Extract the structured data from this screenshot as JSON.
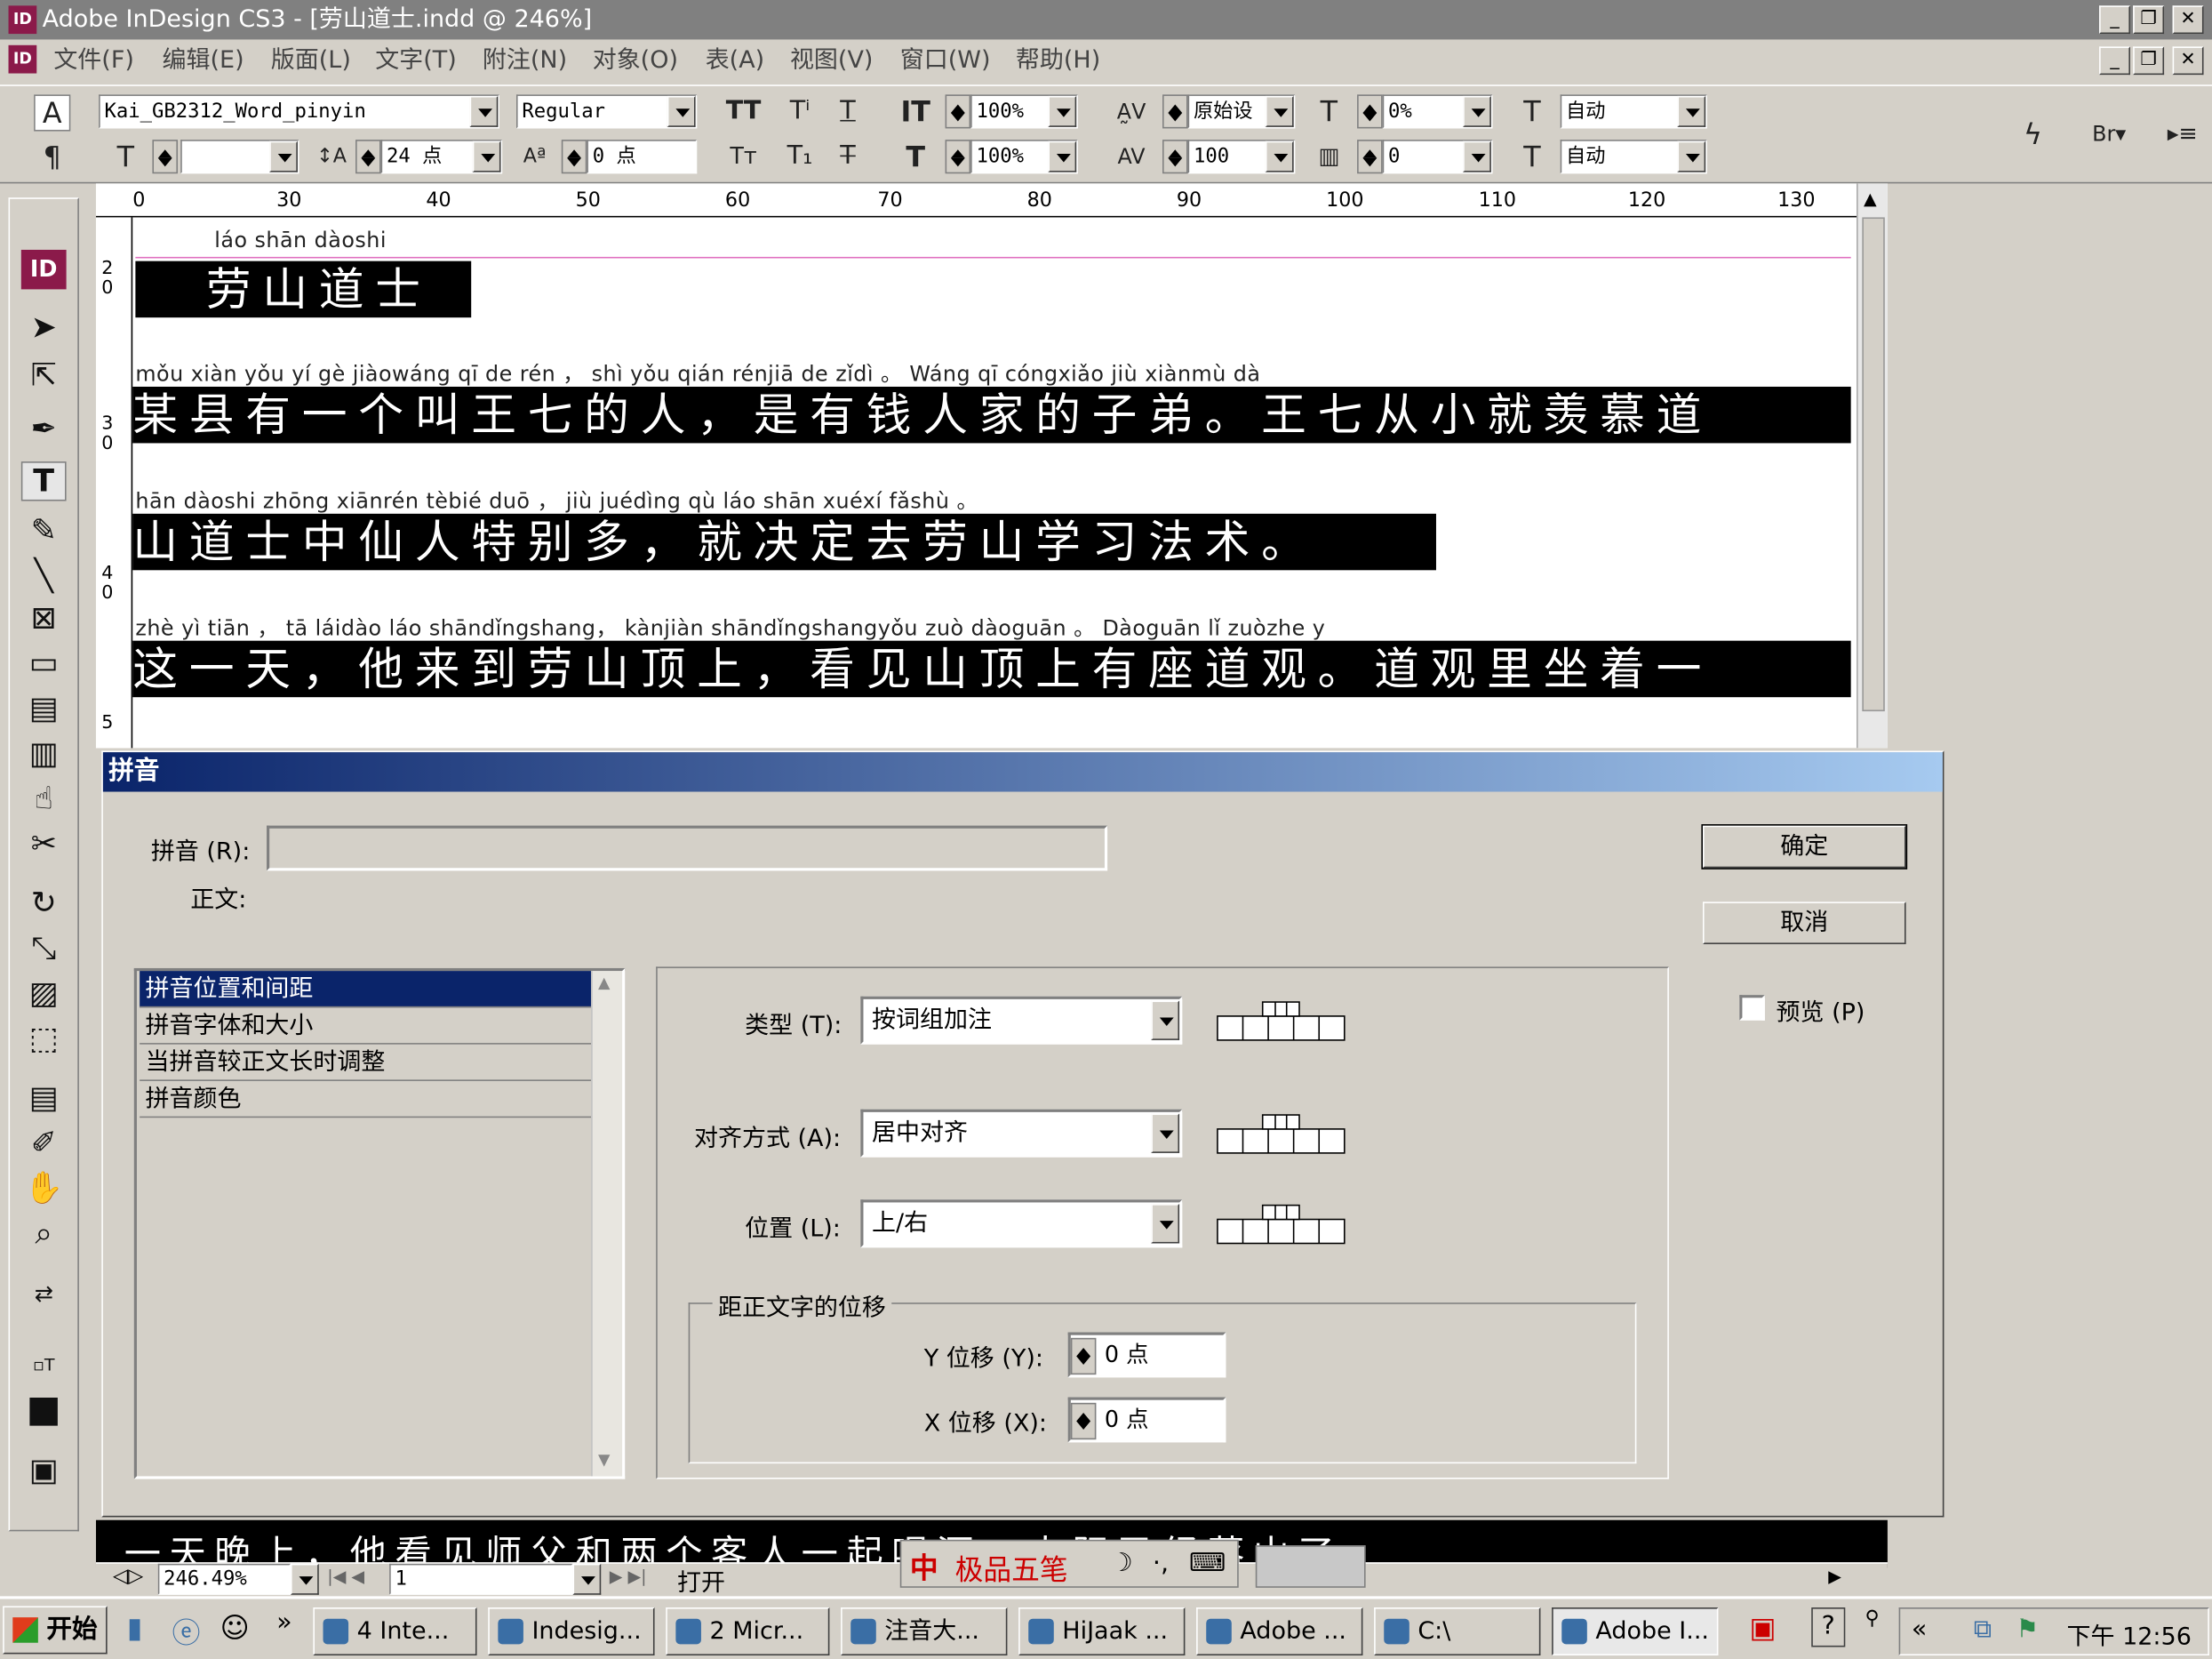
{
  "window": {
    "title": "Adobe InDesign CS3 - [劳山道士.indd @ 246%]",
    "logo": "ID"
  },
  "menu": [
    "文件(F)",
    "编辑(E)",
    "版面(L)",
    "文字(T)",
    "附注(N)",
    "对象(O)",
    "表(A)",
    "视图(V)",
    "窗口(W)",
    "帮助(H)"
  ],
  "control": {
    "font": "Kai_GB2312_Word_pinyin",
    "style": "Regular",
    "size": "24 点",
    "baseline": "0 点",
    "vscale": "100%",
    "hscale": "100%",
    "kerning": "原始设",
    "tracking": "100",
    "skew": "0%",
    "skew2": "0",
    "leading1": "自动",
    "leading2": "自动"
  },
  "ruler": [
    "0",
    "30",
    "40",
    "50",
    "60",
    "70",
    "80",
    "90",
    "100",
    "110",
    "120",
    "130"
  ],
  "vruler": [
    "2\n0",
    "3\n0",
    "4\n0",
    "5"
  ],
  "text": {
    "heading_pinyin": "láo shān  dàoshi",
    "heading": "劳山道士",
    "line1_pinyin": "mǒu xiàn yǒu   yí    gè   jiàowáng qī    de   rén     ，      shì  yǒu qián   rénjiā      de       zǐdì        。  Wáng qī  cóngxiǎo  jiù    xiànmù     dà",
    "line1": "某县有一个叫王七的人，是有钱人家的子弟。王七从小就羡慕道",
    "line2_pinyin": "hān  dàoshi zhōng xiānrén     tèbié     duō    ，      jiù    juédìng    qù   láo shān   xuéxí       fǎshù       。",
    "line2": "山道士中仙人特别多，就决定去劳山学习法术。",
    "line3_pinyin": "zhè   yì   tiān    ，     tā      láidào    láo shāndǐngshang，     kànjiàn   shāndǐngshangyǒu  zuò dàoguān  。   Dàoguān   lǐ     zuòzhe     y",
    "line3": "这一天，他来到劳山顶上，看见山顶上有座道观。道观里坐着一"
  },
  "dialog": {
    "title": "拼音",
    "pinyin_label": "拼音 (R):",
    "pinyin_value": "",
    "body_label": "正文:",
    "ok": "确定",
    "cancel": "取消",
    "preview": "预览 (P)",
    "categories": [
      "拼音位置和间距",
      "拼音字体和大小",
      "当拼音较正文长时调整",
      "拼音颜色"
    ],
    "type_label": "类型 (T):",
    "type_value": "按词组加注",
    "align_label": "对齐方式 (A):",
    "align_value": "居中对齐",
    "pos_label": "位置 (L):",
    "pos_value": "上/右",
    "offset_group": "距正文字的位移",
    "y_label": "Y 位移 (Y):",
    "y_value": "0 点",
    "x_label": "X 位移 (X):",
    "x_value": "0 点"
  },
  "status": {
    "zoom": "246.49%",
    "page": "1",
    "open": "打开",
    "ime": "极品五笔",
    "bottom_text": "一天晚上，他看见师父和两个客人一起喝酒，太阳已经落山了"
  },
  "taskbar": {
    "start": "开始",
    "items": [
      "4 Inte...",
      "Indesig...",
      "2 Micr...",
      "注音大...",
      "HiJaak ...",
      "Adobe ...",
      "C:\\",
      "Adobe I..."
    ],
    "clock": "下午 12:56"
  }
}
